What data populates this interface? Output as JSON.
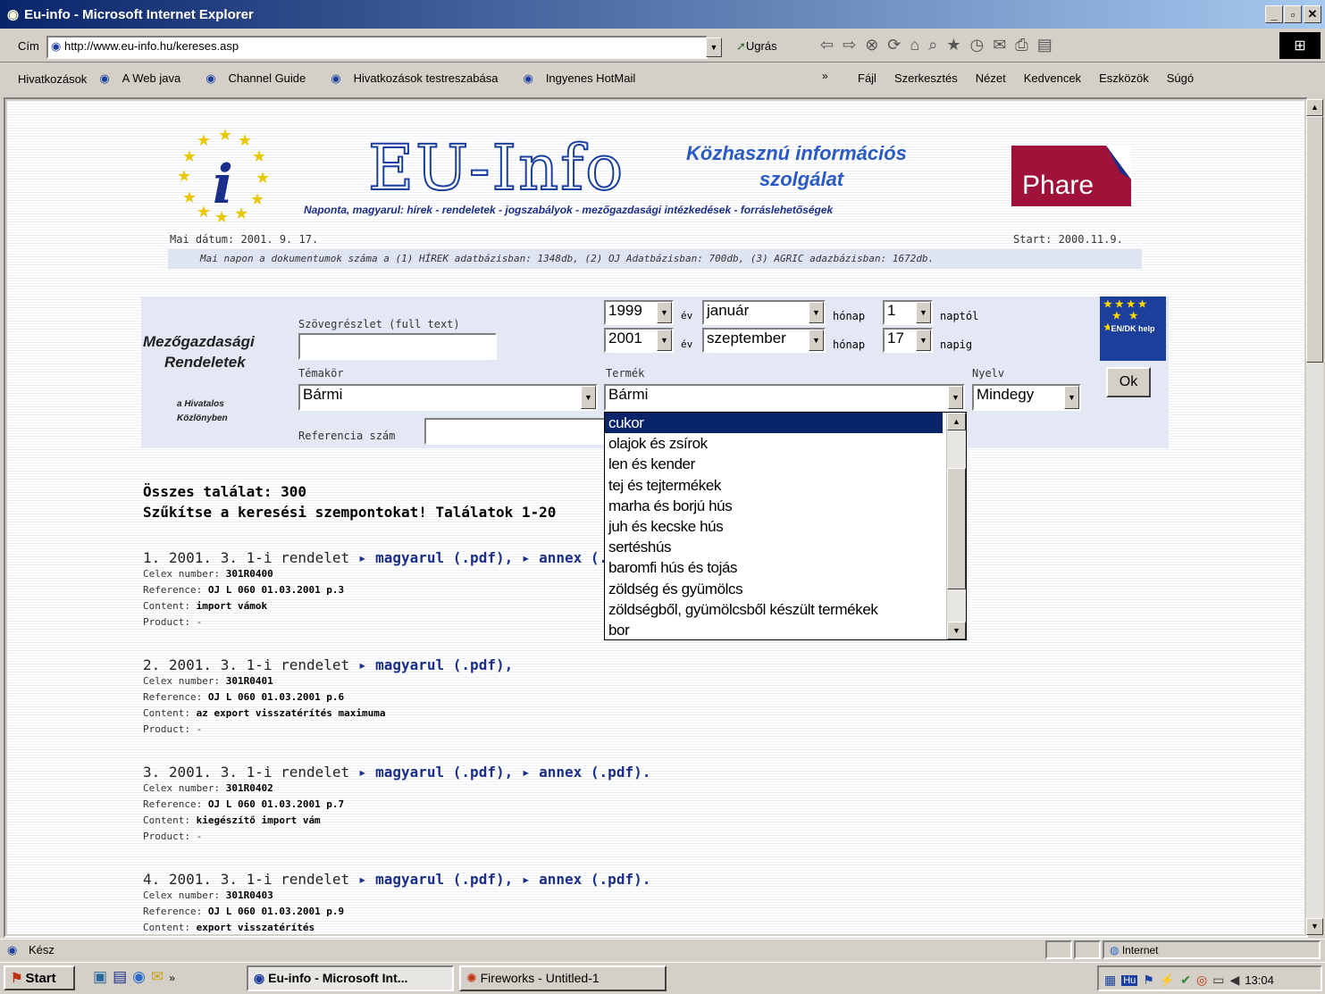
{
  "window": {
    "title": "Eu-info - Microsoft Internet Explorer"
  },
  "address": {
    "label": "Cím",
    "url": "http://www.eu-info.hu/kereses.asp",
    "go": "Ugrás"
  },
  "links": {
    "label": "Hivatkozások",
    "items": [
      "A Web java",
      "Channel Guide",
      "Hivatkozások testreszabása",
      "Ingyenes HotMail"
    ]
  },
  "menu": {
    "items": [
      "Fájl",
      "Szerkesztés",
      "Nézet",
      "Kedvencek",
      "Eszközök",
      "Súgó"
    ]
  },
  "header": {
    "logo_text": "EU-Info",
    "service_line1": "Közhasznú információs",
    "service_line2": "szolgálat",
    "phare": "Phare",
    "tagline": "Naponta, magyarul:  hírek - rendeletek - jogszabályok - mezőgazdasági intézkedések - forráslehetőségek",
    "date": "Mai dátum: 2001. 9. 17.",
    "start": "Start: 2000.11.9.",
    "stats": "Mai napon a dokumentumok száma a (1) HÍREK adatbázisban: 1348db, (2) OJ Adatbázisban: 700db, (3) AGRIC adazbázisban: 1672db."
  },
  "form": {
    "title1": "Mezőgazdasági",
    "title2": "Rendeletek",
    "subtitle1": "a Hivatalos",
    "subtitle2": "Közlönyben",
    "fulltext_label": "Szövegrészlet (full text)",
    "fulltext_value": "",
    "from_year": "1999",
    "from_month": "január",
    "from_day": "1",
    "to_year": "2001",
    "to_month": "szeptember",
    "to_day": "17",
    "ev": "év",
    "honap": "hónap",
    "naptol": "naptól",
    "napig": "napig",
    "temakor_label": "Témakör",
    "temakor_value": "Bármi",
    "termek_label": "Termék",
    "termek_value": "Bármi",
    "nyelv_label": "Nyelv",
    "nyelv_value": "Mindegy",
    "ok": "Ok",
    "ref_label": "Referencia szám",
    "ref_value": "",
    "eu_badge": "EN/DK help"
  },
  "dropdown": {
    "items": [
      "cukor",
      "olajok és zsírok",
      "len és kender",
      "tej és tejtermékek",
      "marha és borjú hús",
      "juh és kecske hús",
      "sertéshús",
      "baromfi hús és tojás",
      "zöldség és gyümölcs",
      "zöldségből, gyümölcsből készült termékek",
      "bor"
    ]
  },
  "results": {
    "total": "Összes találat: 300",
    "narrow": "Szűkítse a keresési szempontokat! Találatok 1-20",
    "labels": {
      "celex": "Celex number: ",
      "ref": "Reference: ",
      "content": "Content: ",
      "product": "Product: "
    },
    "items": [
      {
        "head": "1. 2001. 3. 1-i rendelet ",
        "link1": "▸ magyarul (.pdf),",
        "link2": " ▸ annex (.pdf).",
        "celex": "301R0400",
        "ref": "OJ L 060 01.03.2001 p.3",
        "content": "import vámok",
        "product": "-"
      },
      {
        "head": "2. 2001. 3. 1-i rendelet ",
        "link1": "▸ magyarul (.pdf),",
        "link2": "",
        "celex": "301R0401",
        "ref": "OJ L 060 01.03.2001 p.6",
        "content": "az export visszatérítés maximuma",
        "product": "-"
      },
      {
        "head": "3. 2001. 3. 1-i rendelet ",
        "link1": "▸ magyarul (.pdf),",
        "link2": " ▸ annex (.pdf).",
        "celex": "301R0402",
        "ref": "OJ L 060 01.03.2001 p.7",
        "content": "kiegészítő import vám",
        "product": "-"
      },
      {
        "head": "4. 2001. 3. 1-i rendelet ",
        "link1": "▸ magyarul (.pdf),",
        "link2": " ▸ annex (.pdf).",
        "celex": "301R0403",
        "ref": "OJ L 060 01.03.2001 p.9",
        "content": "export visszatérítés",
        "product": ""
      }
    ]
  },
  "status": {
    "text": "Kész",
    "zone": "Internet"
  },
  "taskbar": {
    "start": "Start",
    "task1": "Eu-info - Microsoft Int...",
    "task2": "Fireworks - Untitled-1",
    "clock": "13:04",
    "lang": "Hu"
  }
}
